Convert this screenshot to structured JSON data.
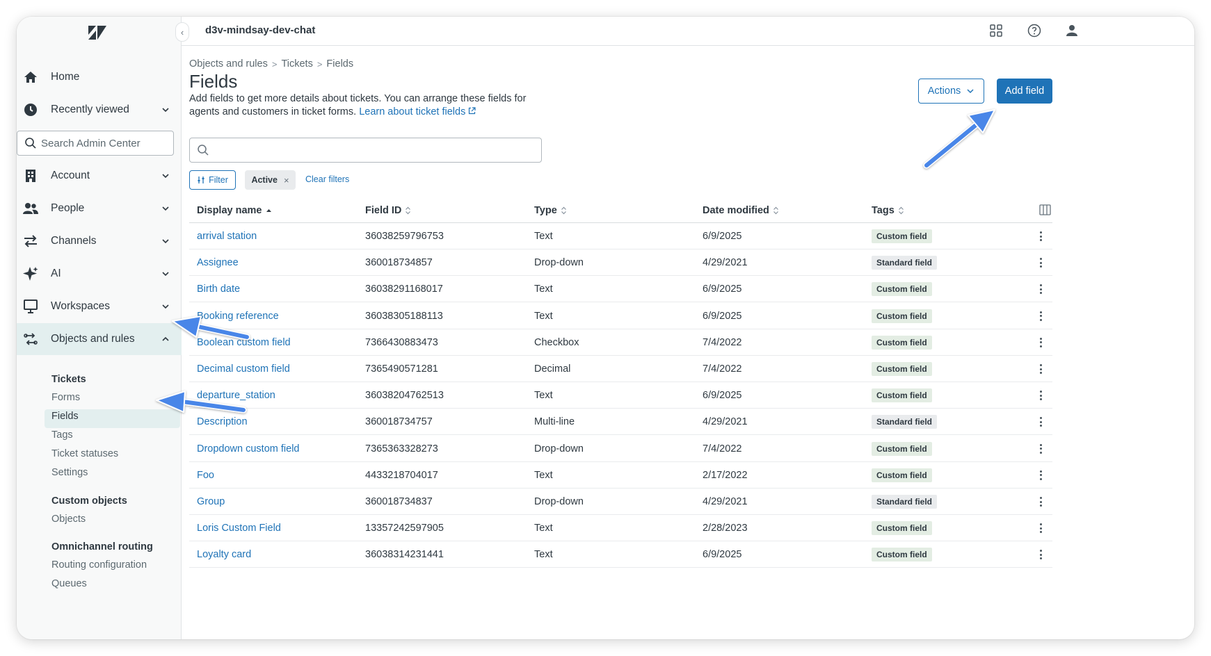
{
  "sidebar": {
    "collapse_glyph": "‹",
    "search_placeholder": "Search Admin Center",
    "items": [
      {
        "label": "Home",
        "icon": "home-icon"
      },
      {
        "label": "Recently viewed",
        "icon": "clock-icon"
      },
      {
        "label": "Account",
        "icon": "building-icon"
      },
      {
        "label": "People",
        "icon": "people-icon"
      },
      {
        "label": "Channels",
        "icon": "arrows-icon"
      },
      {
        "label": "AI",
        "icon": "sparkle-icon"
      },
      {
        "label": "Workspaces",
        "icon": "monitor-icon"
      },
      {
        "label": "Objects and rules",
        "icon": "objects-rules-icon"
      }
    ],
    "submenu": {
      "tickets_heading": "Tickets",
      "tickets_items": [
        "Forms",
        "Fields",
        "Tags",
        "Ticket statuses",
        "Settings"
      ],
      "custom_objects_heading": "Custom objects",
      "custom_objects_items": [
        "Objects"
      ],
      "omnichannel_heading": "Omnichannel routing",
      "omnichannel_items": [
        "Routing configuration",
        "Queues"
      ]
    }
  },
  "topbar": {
    "brand": "d3v-mindsay-dev-chat"
  },
  "breadcrumb": [
    "Objects and rules",
    "Tickets",
    "Fields"
  ],
  "breadcrumb_sep": ">",
  "page": {
    "title": "Fields",
    "description": "Add fields to get more details about tickets. You can arrange these fields for agents and customers in ticket forms.",
    "learn_link": "Learn about ticket fields",
    "actions_label": "Actions",
    "add_label": "Add field"
  },
  "filters": {
    "filter_label": "Filter",
    "active_chip": "Active",
    "chip_close": "×",
    "clear_label": "Clear filters"
  },
  "table": {
    "headers": [
      "Display name",
      "Field ID",
      "Type",
      "Date modified",
      "Tags"
    ],
    "rows": [
      {
        "name": "arrival station",
        "id": "36038259796753",
        "type": "Text",
        "date": "6/9/2025",
        "tag": "Custom field"
      },
      {
        "name": "Assignee",
        "id": "360018734857",
        "type": "Drop-down",
        "date": "4/29/2021",
        "tag": "Standard field"
      },
      {
        "name": "Birth date",
        "id": "36038291168017",
        "type": "Text",
        "date": "6/9/2025",
        "tag": "Custom field"
      },
      {
        "name": "Booking reference",
        "id": "36038305188113",
        "type": "Text",
        "date": "6/9/2025",
        "tag": "Custom field"
      },
      {
        "name": "Boolean custom field",
        "id": "7366430883473",
        "type": "Checkbox",
        "date": "7/4/2022",
        "tag": "Custom field"
      },
      {
        "name": "Decimal custom field",
        "id": "7365490571281",
        "type": "Decimal",
        "date": "7/4/2022",
        "tag": "Custom field"
      },
      {
        "name": "departure_station",
        "id": "36038204762513",
        "type": "Text",
        "date": "6/9/2025",
        "tag": "Custom field"
      },
      {
        "name": "Description",
        "id": "360018734757",
        "type": "Multi-line",
        "date": "4/29/2021",
        "tag": "Standard field"
      },
      {
        "name": "Dropdown custom field",
        "id": "7365363328273",
        "type": "Drop-down",
        "date": "7/4/2022",
        "tag": "Custom field"
      },
      {
        "name": "Foo",
        "id": "4433218704017",
        "type": "Text",
        "date": "2/17/2022",
        "tag": "Custom field"
      },
      {
        "name": "Group",
        "id": "360018734837",
        "type": "Drop-down",
        "date": "4/29/2021",
        "tag": "Standard field"
      },
      {
        "name": "Loris Custom Field",
        "id": "13357242597905",
        "type": "Text",
        "date": "2/28/2023",
        "tag": "Custom field"
      },
      {
        "name": "Loyalty card",
        "id": "36038314231441",
        "type": "Text",
        "date": "6/9/2025",
        "tag": "Custom field"
      }
    ]
  },
  "colors": {
    "accent": "#1f73b7",
    "sidebar_active": "#e3efef",
    "annotation_arrow": "#4a86e8"
  }
}
